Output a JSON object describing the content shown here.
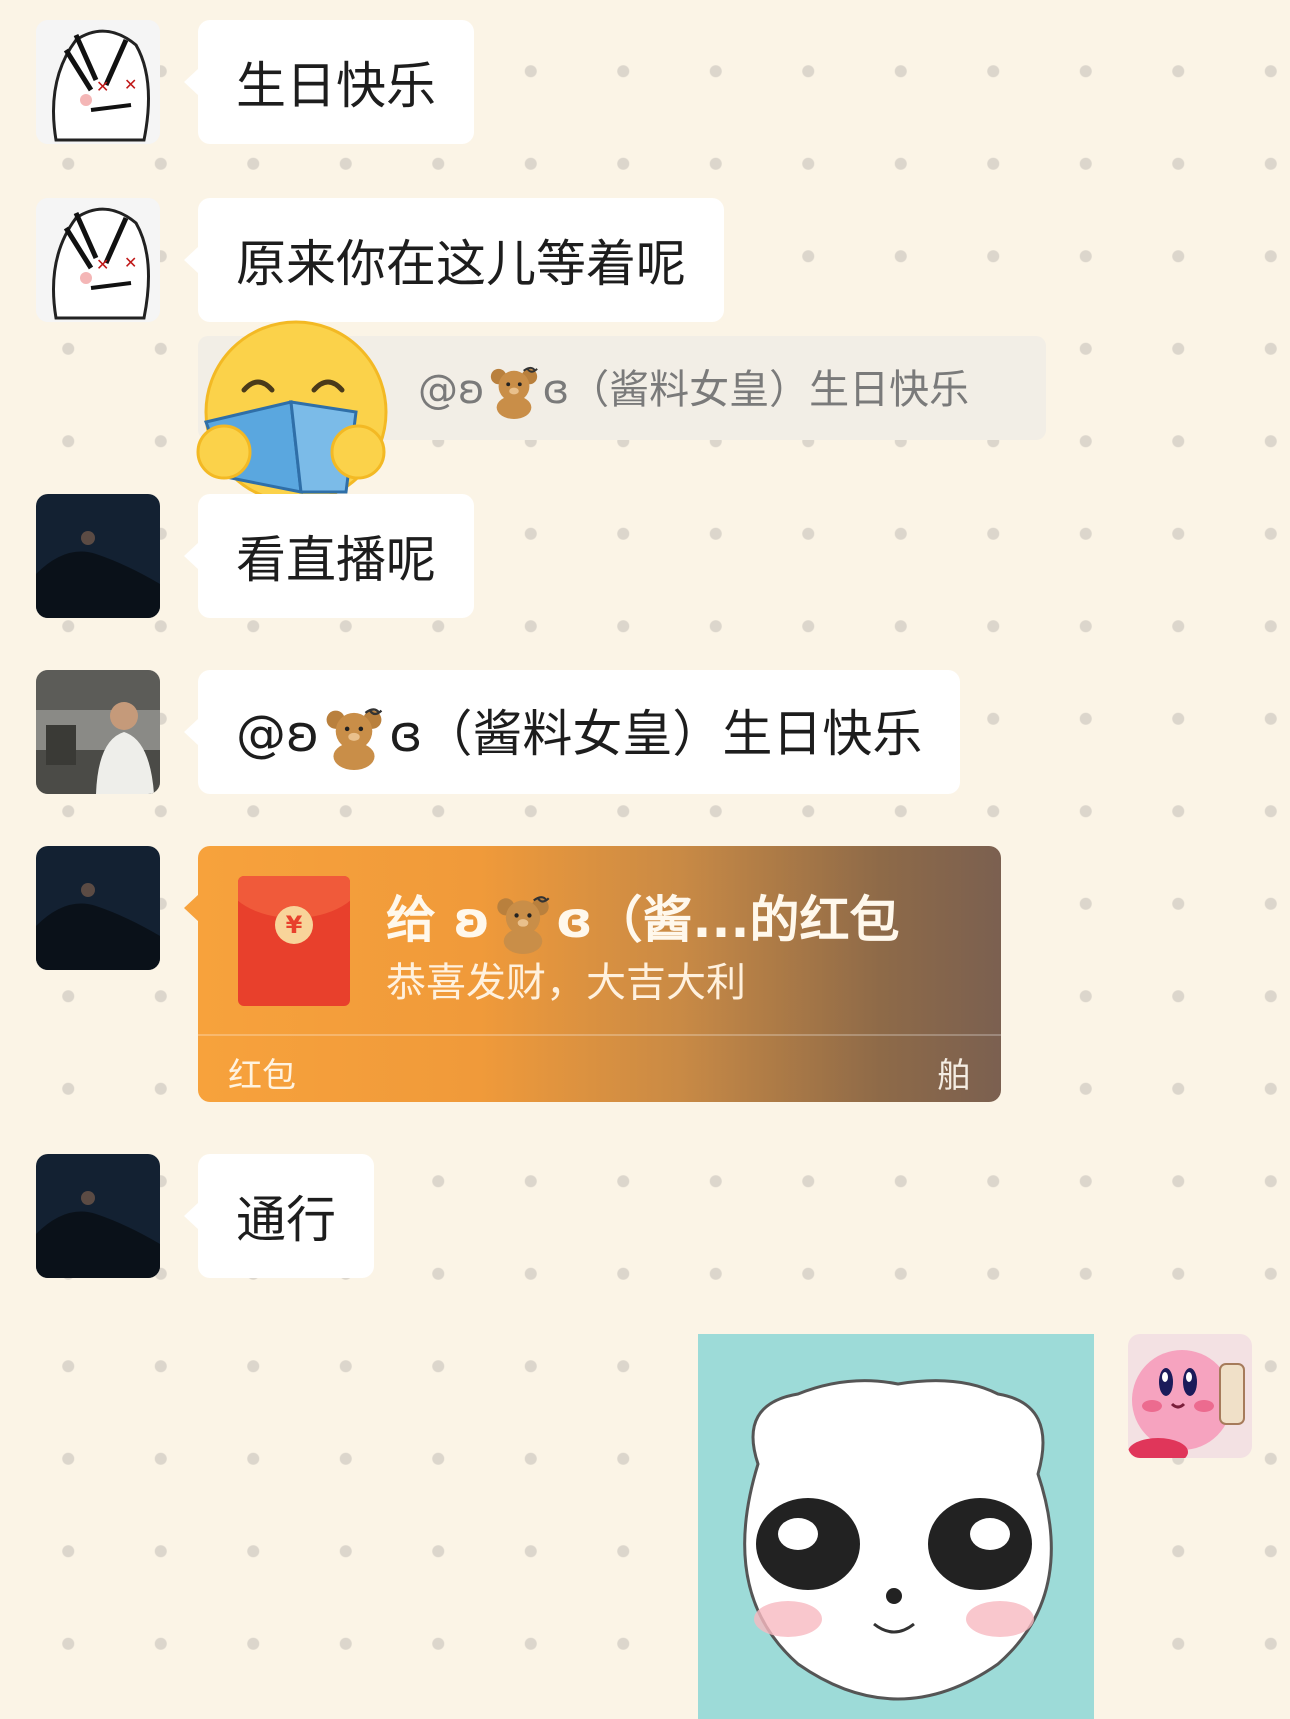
{
  "messages": [
    {
      "text": "生日快乐"
    },
    {
      "text": "原来你在这儿等着呢"
    },
    {
      "text": "看直播呢"
    },
    {
      "text_prefix": "@ʚ",
      "text_suffix": "ɞ（酱料女皇）生日快乐"
    },
    {
      "text": "通行"
    }
  ],
  "quote": {
    "prefix": "@ʚ",
    "suffix": "ɞ（酱料女皇）生日快乐"
  },
  "red_packet": {
    "title_prefix": "给 ʚ",
    "title_suffix": "ɞ（酱...的红包",
    "subtitle": "恭喜发财，大吉大利",
    "label": "红包",
    "brand": "舶",
    "coin": "¥"
  },
  "icons": {
    "teddy": "teddy-bear-emoji",
    "reader": "reading-book-emoji"
  },
  "colors": {
    "bubble": "#ffffff",
    "background": "#fbf4e6",
    "red_packet_start": "#f7a23c",
    "red_packet_end": "#7b6050"
  }
}
